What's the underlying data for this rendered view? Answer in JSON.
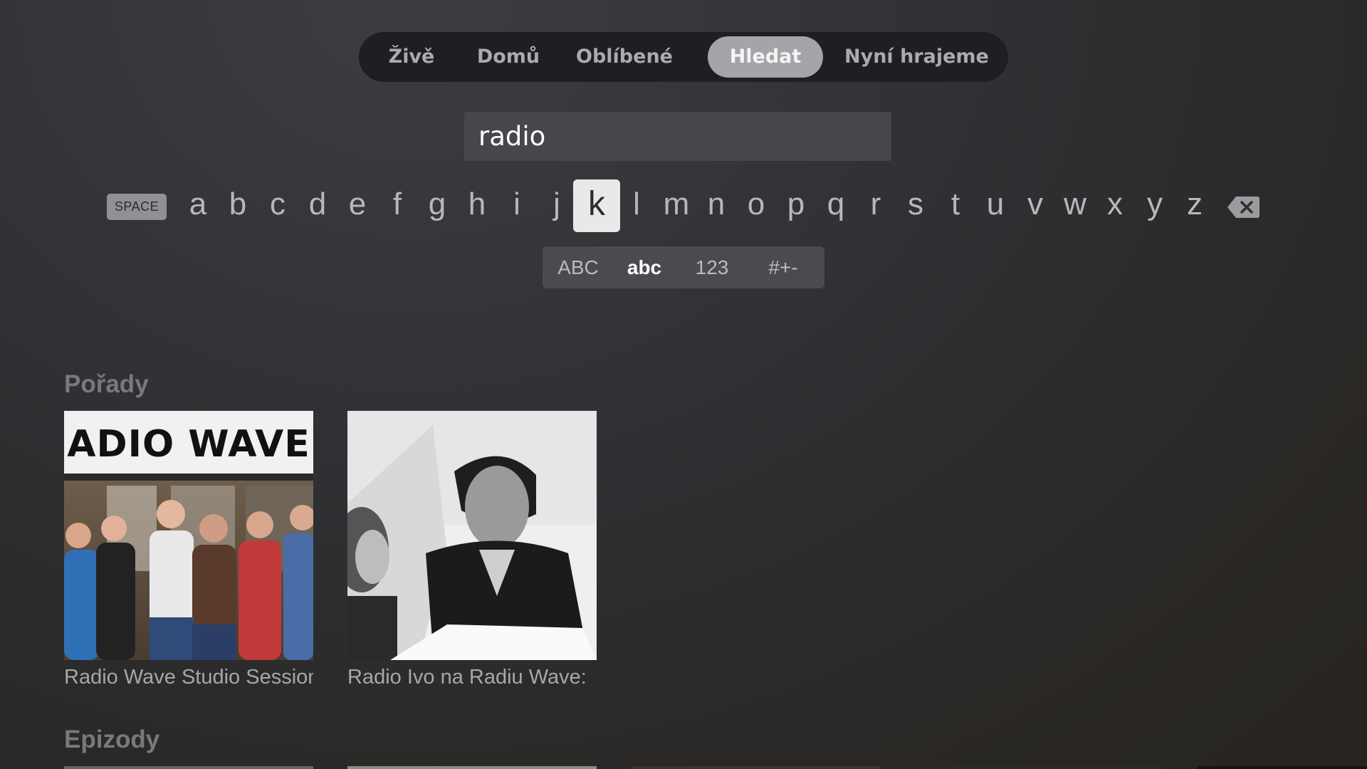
{
  "nav": {
    "tabs": [
      {
        "label": "Živě",
        "active": false
      },
      {
        "label": "Domů",
        "active": false
      },
      {
        "label": "Oblíbené",
        "active": false
      },
      {
        "label": "Hledat",
        "active": true
      },
      {
        "label": "Nyní hrajeme",
        "active": false
      }
    ]
  },
  "search": {
    "value": "radio"
  },
  "keyboard": {
    "space_label": "SPACE",
    "letters": [
      "a",
      "b",
      "c",
      "d",
      "e",
      "f",
      "g",
      "h",
      "i",
      "j",
      "k",
      "l",
      "m",
      "n",
      "o",
      "p",
      "q",
      "r",
      "s",
      "t",
      "u",
      "v",
      "w",
      "x",
      "y",
      "z"
    ],
    "focused_key": "k",
    "delete_icon": "backspace-icon",
    "modes": [
      {
        "label": "ABC",
        "active": false
      },
      {
        "label": "abc",
        "active": true
      },
      {
        "label": "123",
        "active": false
      },
      {
        "label": "#+-",
        "active": false
      }
    ]
  },
  "shows": {
    "title": "Pořady",
    "items": [
      {
        "title": "Radio Wave Studio Session",
        "image_sign_text": "ADIO WAVE"
      },
      {
        "title": "Radio Ivo na Radiu Wave:"
      }
    ]
  },
  "episodes": {
    "title": "Epizody"
  },
  "colors": {
    "nav_bg": "#1e1f22",
    "active_tab": "#a3a5a8",
    "focused_key": "#e9e9ea",
    "section_title": "#77797c"
  }
}
